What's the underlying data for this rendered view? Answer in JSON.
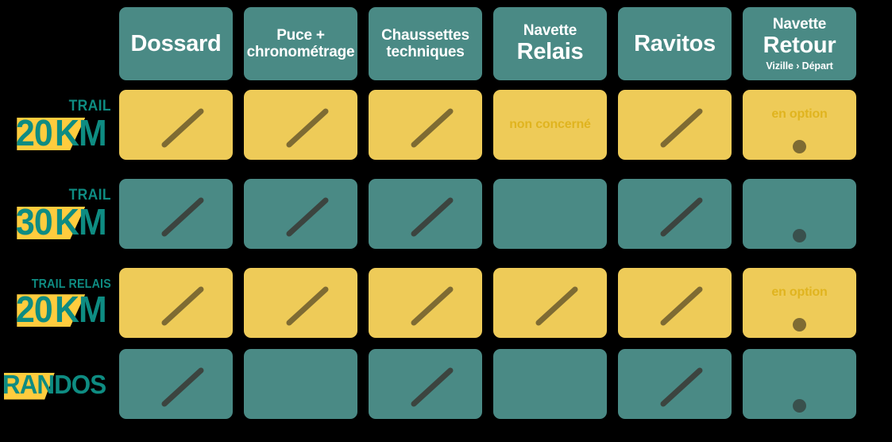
{
  "colors": {
    "background": "#000000",
    "teal": "#4A8A85",
    "yellow": "#EECB58",
    "brand_teal_text": "#0E8C82",
    "banner_yellow": "#FFCC3E",
    "note_gold": "#E0B41F",
    "tick_on_yellow": "#7E6B33",
    "tick_on_teal": "#3C443F"
  },
  "columns": [
    {
      "id": "dossard",
      "title": "Dossard",
      "title2": "",
      "subtitle": "",
      "size": "large"
    },
    {
      "id": "puce",
      "title": "Puce +",
      "title2": "chronométrage",
      "subtitle": "",
      "size": "medium"
    },
    {
      "id": "chaussettes",
      "title": "Chaussettes",
      "title2": "techniques",
      "subtitle": "",
      "size": "medium"
    },
    {
      "id": "navette-relais",
      "title": "Navette",
      "title2": "Relais",
      "subtitle": "",
      "size": "mixed"
    },
    {
      "id": "ravitos",
      "title": "Ravitos",
      "title2": "",
      "subtitle": "",
      "size": "large"
    },
    {
      "id": "navette-retour",
      "title": "Navette",
      "title2": "Retour",
      "subtitle": "Vizille  ›  Départ",
      "size": "mixed"
    }
  ],
  "rows": [
    {
      "id": "trail-20km",
      "kicker": "TRAIL",
      "kicker_size": "normal",
      "number": "20",
      "unit": "KM",
      "fill": "yellow",
      "cells": [
        {
          "col": "dossard",
          "state": "check",
          "note": ""
        },
        {
          "col": "puce",
          "state": "check",
          "note": ""
        },
        {
          "col": "chaussettes",
          "state": "check",
          "note": ""
        },
        {
          "col": "navette-relais",
          "state": "text",
          "note": "non concerné"
        },
        {
          "col": "ravitos",
          "state": "check",
          "note": ""
        },
        {
          "col": "navette-retour",
          "state": "option",
          "note": "en option"
        }
      ]
    },
    {
      "id": "trail-30km",
      "kicker": "TRAIL",
      "kicker_size": "normal",
      "number": "30",
      "unit": "KM",
      "fill": "teal",
      "cells": [
        {
          "col": "dossard",
          "state": "check",
          "note": ""
        },
        {
          "col": "puce",
          "state": "check",
          "note": ""
        },
        {
          "col": "chaussettes",
          "state": "check",
          "note": ""
        },
        {
          "col": "navette-relais",
          "state": "empty",
          "note": ""
        },
        {
          "col": "ravitos",
          "state": "check",
          "note": ""
        },
        {
          "col": "navette-retour",
          "state": "option",
          "note": ""
        }
      ]
    },
    {
      "id": "trail-relais-20km",
      "kicker": "TRAIL RELAIS",
      "kicker_size": "small",
      "number": "20",
      "unit": "KM",
      "fill": "yellow",
      "cells": [
        {
          "col": "dossard",
          "state": "check",
          "note": ""
        },
        {
          "col": "puce",
          "state": "check",
          "note": ""
        },
        {
          "col": "chaussettes",
          "state": "check",
          "note": ""
        },
        {
          "col": "navette-relais",
          "state": "check",
          "note": ""
        },
        {
          "col": "ravitos",
          "state": "check",
          "note": ""
        },
        {
          "col": "navette-retour",
          "state": "option",
          "note": "en option"
        }
      ]
    },
    {
      "id": "randos",
      "kicker": "",
      "kicker_size": "normal",
      "number": "RANDOS",
      "unit": "",
      "fill": "teal",
      "cells": [
        {
          "col": "dossard",
          "state": "check",
          "note": ""
        },
        {
          "col": "puce",
          "state": "empty",
          "note": ""
        },
        {
          "col": "chaussettes",
          "state": "check",
          "note": ""
        },
        {
          "col": "navette-relais",
          "state": "empty",
          "note": ""
        },
        {
          "col": "ravitos",
          "state": "check",
          "note": ""
        },
        {
          "col": "navette-retour",
          "state": "option",
          "note": ""
        }
      ]
    }
  ]
}
